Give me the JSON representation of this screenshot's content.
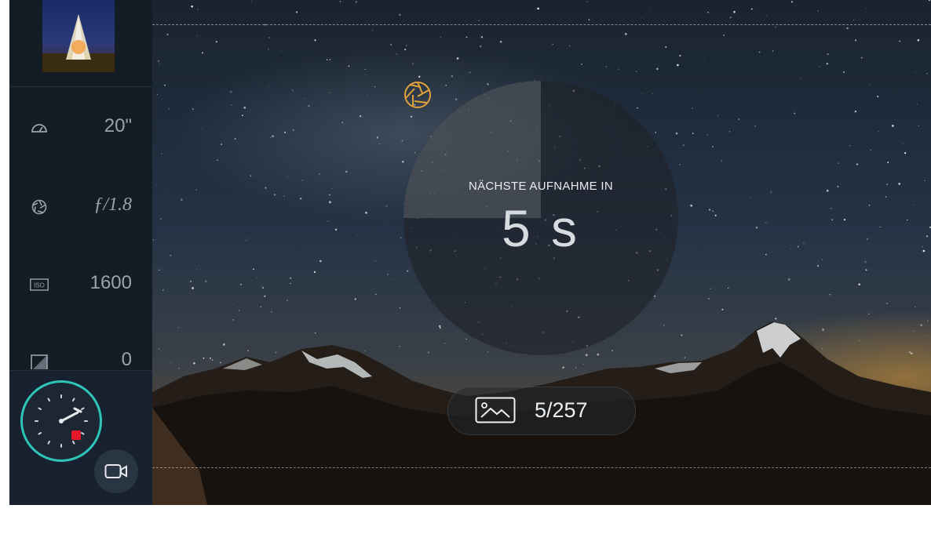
{
  "sidebar": {
    "thumbnail_icon": "last-photo-thumbnail",
    "params": [
      {
        "id": "shutter",
        "icon": "speedometer-icon",
        "value": "20\""
      },
      {
        "id": "aperture",
        "icon": "aperture-icon",
        "value": "ƒ/1.8"
      },
      {
        "id": "iso",
        "icon": "iso-icon",
        "icon_text": "ISO",
        "value": "1600"
      },
      {
        "id": "ev",
        "icon": "exposure-compensation-icon",
        "value": "0"
      }
    ],
    "timelapse_button": {
      "icon": "timelapse-dial-icon",
      "recording_indicator_color": "#e3192b"
    },
    "video_mode_button": {
      "icon": "video-camera-icon"
    }
  },
  "viewfinder": {
    "countdown": {
      "label": "NÄCHSTE AUFNAHME IN",
      "value": "5 s",
      "progress_fraction": 0.25,
      "shutter_icon": "shutter-icon",
      "shutter_icon_color": "#e0a13a"
    },
    "shot_counter": {
      "icon": "gallery-icon",
      "value": "5/257"
    }
  },
  "colors": {
    "accent_teal": "#2ec4b6",
    "accent_orange": "#e0a13a",
    "record_red": "#e3192b",
    "sidebar_bg": "#141c26"
  }
}
